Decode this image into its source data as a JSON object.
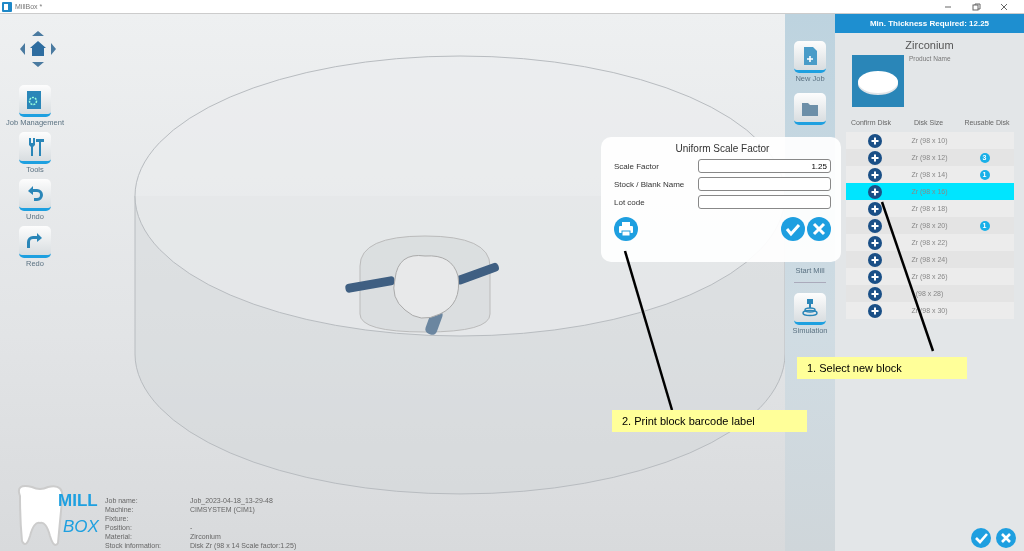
{
  "window": {
    "title": "MillBox *"
  },
  "left_toolbar": [
    {
      "label": "Job Management",
      "kind": "job"
    },
    {
      "label": "Tools",
      "kind": "tools"
    },
    {
      "label": "Undo",
      "kind": "undo"
    },
    {
      "label": "Redo",
      "kind": "redo"
    }
  ],
  "logo": {
    "line1": "MILL",
    "line2": "BOX"
  },
  "job_info": [
    {
      "label": "Job name:",
      "value": "Job_2023-04-18_13-29-48"
    },
    {
      "label": "Machine:",
      "value": "CIMSYSTEM (CIM1)"
    },
    {
      "label": "Fixture:"
    },
    {
      "label": "Position:",
      "value": "-"
    },
    {
      "label": "Material:",
      "value": "Zirconium"
    },
    {
      "label": "Stock information:",
      "value": "Disk Zr (98 x 14 Scale factor:1.25)"
    }
  ],
  "side_toolbar": [
    {
      "label": "New Job",
      "kind": "newjob"
    },
    {
      "kind": "folder"
    },
    {
      "label": "Start Mill",
      "kind": "text"
    },
    {
      "label": "Simulation",
      "kind": "simulation"
    }
  ],
  "dialog": {
    "title": "Uniform Scale Factor",
    "fields": [
      {
        "label": "Scale Factor",
        "value": "1.25"
      },
      {
        "label": "Stock / Blank Name"
      },
      {
        "label": "Lot code"
      }
    ]
  },
  "panel": {
    "header": "Min. Thickness Required: 12.25",
    "material": "Zirconium",
    "product_label": "Product Name",
    "columns": [
      "Confirm Disk",
      "Disk Size",
      "Reusable Disk"
    ],
    "rows": [
      {
        "size": "Zr (98 x 10)",
        "selected": false
      },
      {
        "size": "Zr (98 x 12)",
        "selected": false,
        "reusable": "3"
      },
      {
        "size": "Zr (98 x 14)",
        "selected": false,
        "reusable": "1"
      },
      {
        "size": "Zr (98 x 16)",
        "selected": true
      },
      {
        "size": "Zr (98 x 18)",
        "selected": false
      },
      {
        "size": "Zr (98 x 20)",
        "selected": false,
        "reusable": "1"
      },
      {
        "size": "Zr (98 x 22)",
        "selected": false
      },
      {
        "size": "Zr (98 x 24)",
        "selected": false
      },
      {
        "size": "Zr (98 x 26)",
        "selected": false
      },
      {
        "size": "(98 x 28)",
        "selected": false
      },
      {
        "size": "Zr (98 x 30)",
        "selected": false
      }
    ]
  },
  "callouts": [
    {
      "text": "1. Select new block"
    },
    {
      "text": "2. Print block barcode label"
    }
  ]
}
